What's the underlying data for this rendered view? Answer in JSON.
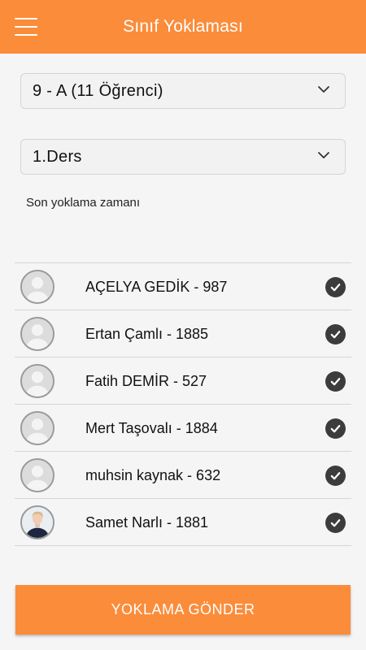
{
  "app": {
    "title": "Sınıf Yoklaması",
    "accent_color": "#fb8c3a"
  },
  "filters": {
    "class_value": "9 - A (11 Öğrenci)",
    "lesson_value": "1.Ders",
    "dropdown_icon": "chevron-down-icon"
  },
  "last_attendance_label": "Son yoklama zamanı",
  "students": [
    {
      "name": "AÇELYA GEDİK - 987",
      "avatar": "default-avatar",
      "present": true
    },
    {
      "name": "Ertan Çamlı - 1885",
      "avatar": "default-avatar",
      "present": true
    },
    {
      "name": "Fatih DEMİR - 527",
      "avatar": "default-avatar",
      "present": true
    },
    {
      "name": "Mert Taşovalı - 1884",
      "avatar": "default-avatar",
      "present": true
    },
    {
      "name": "muhsin kaynak - 632",
      "avatar": "default-avatar",
      "present": true
    },
    {
      "name": "Samet Narlı - 1881",
      "avatar": "photo-avatar",
      "present": true
    }
  ],
  "submit_label": "YOKLAMA GÖNDER"
}
